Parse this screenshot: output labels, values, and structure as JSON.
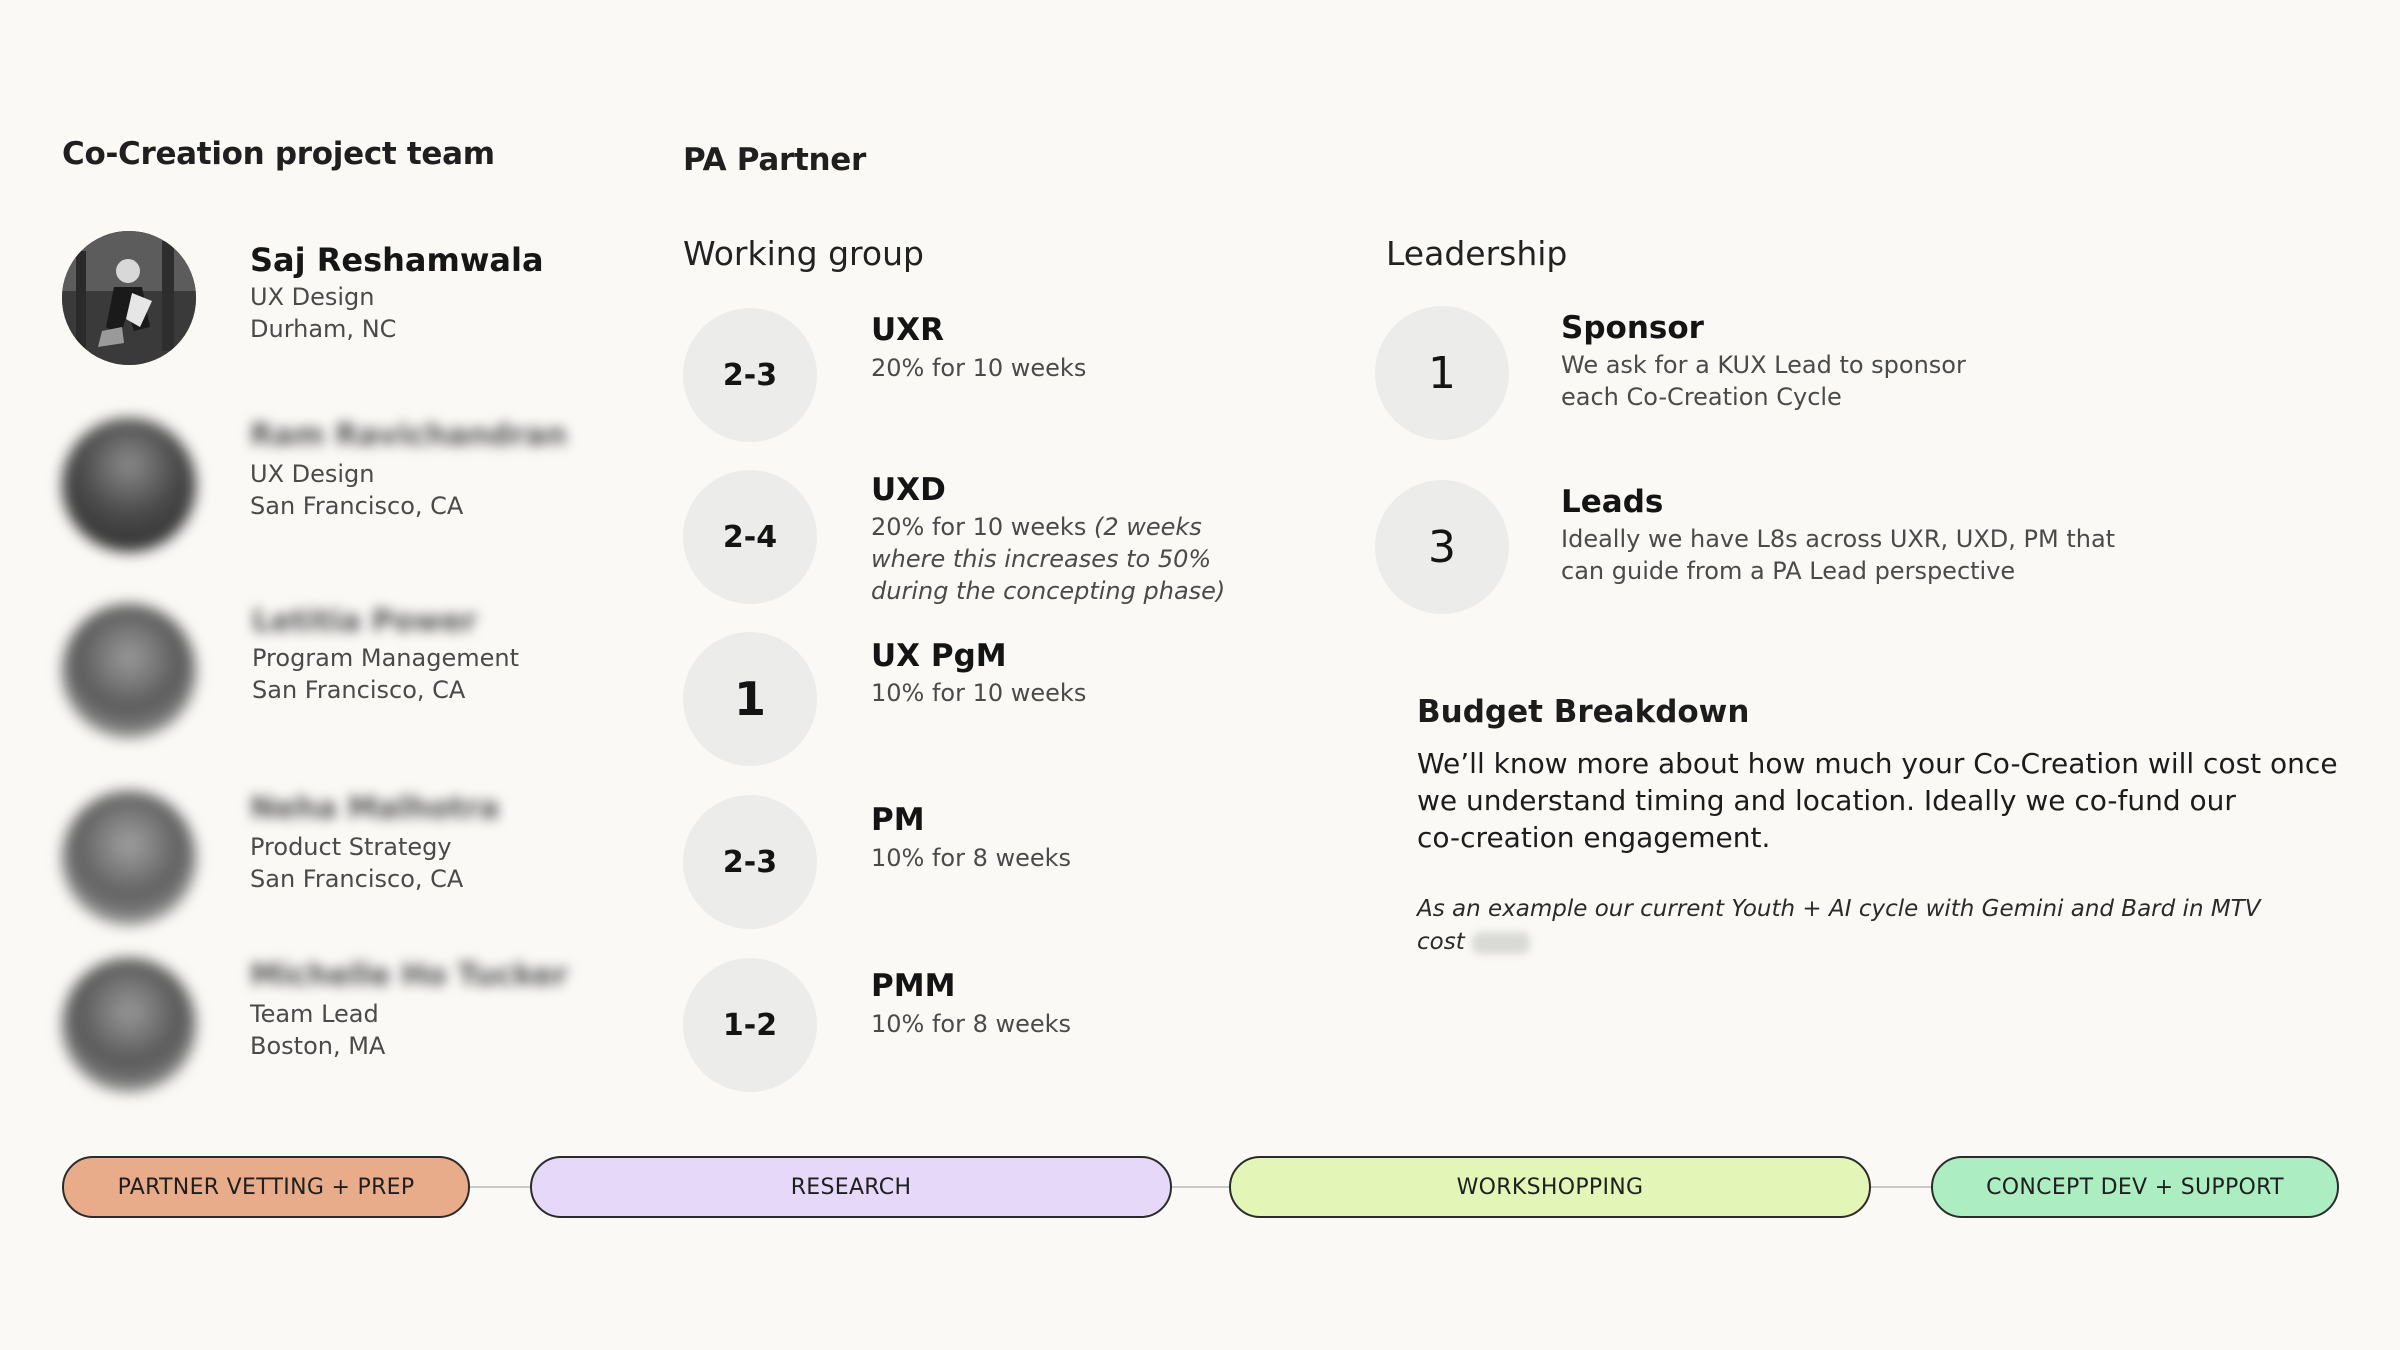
{
  "team": {
    "title": "Co-Creation project team",
    "members": [
      {
        "name": "Saj Reshamwala",
        "role": "UX Design",
        "location": "Durham, NC"
      },
      {
        "name": "Ram Ravichandran",
        "role": "UX Design",
        "location": "San Francisco, CA"
      },
      {
        "name": "Letitia Power",
        "role": "Program Management",
        "location": "San Francisco, CA"
      },
      {
        "name": "Neha Malhotra",
        "role": "Product Strategy",
        "location": "San Francisco, CA"
      },
      {
        "name": "Michelle Ho Tucker",
        "role": "Team Lead",
        "location": "Boston, MA"
      }
    ]
  },
  "partner": {
    "title": "PA Partner",
    "working_group": {
      "title": "Working group",
      "roles": [
        {
          "count": "2-3",
          "title": "UXR",
          "desc": "20% for 10 weeks"
        },
        {
          "count": "2-4",
          "title": "UXD",
          "desc": "20% for 10 weeks",
          "desc_italic": "(2 weeks where this increases to 50% during the concepting phase)"
        },
        {
          "count": "1",
          "title": "UX PgM",
          "desc": "10% for 10 weeks"
        },
        {
          "count": "2-3",
          "title": "PM",
          "desc": "10% for 8 weeks"
        },
        {
          "count": "1-2",
          "title": "PMM",
          "desc": "10% for 8 weeks"
        }
      ]
    },
    "leadership": {
      "title": "Leadership",
      "roles": [
        {
          "count": "1",
          "title": "Sponsor",
          "desc_line1": "We ask for a KUX Lead to sponsor",
          "desc_line2": "each Co-Creation Cycle"
        },
        {
          "count": "3",
          "title": "Leads",
          "desc_line1": "Ideally we have L8s across UXR, UXD, PM that",
          "desc_line2": "can guide from a PA Lead perspective"
        }
      ]
    }
  },
  "budget": {
    "title": "Budget Breakdown",
    "body_line1": "We’ll know more about how much your Co-Creation will cost once",
    "body_line2": "we understand timing and location. Ideally we co-fund our",
    "body_line3": "co-creation engagement.",
    "example_line1": "As an example our current Youth + AI cycle with Gemini and Bard in MTV",
    "example_line2": "cost"
  },
  "timeline": {
    "phases": [
      {
        "label": "PARTNER VETTING + PREP",
        "color": "#e9ac8a"
      },
      {
        "label": "RESEARCH",
        "color": "#e6d8f8"
      },
      {
        "label": "WORKSHOPPING",
        "color": "#e3f6b8"
      },
      {
        "label": "CONCEPT DEV + SUPPORT",
        "color": "#aceec2"
      }
    ]
  }
}
